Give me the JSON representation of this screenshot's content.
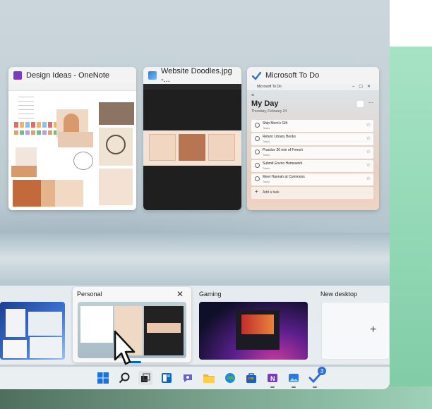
{
  "windows": [
    {
      "title": "Design Ideas - OneNote",
      "icon": "onenote-icon"
    },
    {
      "title": "Website Doodles.jpg -...",
      "icon": "photos-icon"
    },
    {
      "title": "Microsoft To Do",
      "icon": "todo-icon"
    }
  ],
  "todo": {
    "app_title": "Microsoft To Do",
    "heading": "My Day",
    "date": "Thursday, February 24",
    "tasks": [
      {
        "title": "Ship Mom's Gift",
        "list": "Tasks"
      },
      {
        "title": "Return Library Books",
        "list": "Tasks"
      },
      {
        "title": "Practice 30 min of French",
        "list": "Tasks"
      },
      {
        "title": "Submit Enviro Homework",
        "list": "Tasks"
      },
      {
        "title": "Meet Hannah at Commons",
        "list": "Tasks"
      }
    ],
    "add_task": "Add a task"
  },
  "desktops": {
    "personal": "Personal",
    "gaming": "Gaming",
    "new_desktop": "New desktop",
    "new_desktop_plus": "+",
    "close_glyph": "✕"
  },
  "taskbar": {
    "icons": [
      "windows-start-icon",
      "search-icon",
      "task-view-icon",
      "widgets-icon",
      "chat-icon",
      "file-explorer-icon",
      "edge-icon",
      "store-icon",
      "onenote-icon",
      "photos-icon",
      "todo-icon"
    ],
    "todo_badge": "3"
  },
  "colors": {
    "accent_green": "#9fdcbc",
    "onenote": "#7a3bbd",
    "todo": "#2f6fd6",
    "selection": "#0067c0"
  }
}
